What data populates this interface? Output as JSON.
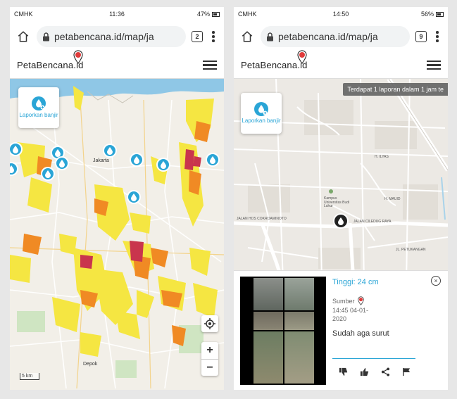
{
  "left_screen": {
    "status": {
      "carrier": "CMHK",
      "time": "11:36",
      "battery": "47%"
    },
    "browser": {
      "url": "petabencana.id/map/ja",
      "tab_count": "2"
    },
    "app": {
      "logo_text": "PetaBencana",
      "logo_suffix": ".id"
    },
    "map": {
      "report_button_label": "Laporkan banjir",
      "city_label": "Jakarta",
      "district_label": "Depok",
      "scale_label": "5 km",
      "zoom_in": "+",
      "zoom_out": "−"
    }
  },
  "right_screen": {
    "status": {
      "carrier": "CMHK",
      "time": "14:50",
      "battery": "56%"
    },
    "browser": {
      "url": "petabencana.id/map/ja",
      "tab_count": "9"
    },
    "app": {
      "logo_text": "PetaBencana",
      "logo_suffix": ".id"
    },
    "map": {
      "report_button_label": "Laporkan banjir",
      "notice": "Terdapat 1 laporan dalam 1 jam te",
      "road_labels": [
        "JALAN HOS COKROAMINOTO",
        "JALAN CILEDUG RAYA",
        "H. ILYAS",
        "Kampus Universitas Budi Luhur",
        "H. MAUID",
        "JL. PETUKANGAN"
      ]
    },
    "report": {
      "height_label": "Tinggi: 24 cm",
      "source_label": "Sumber",
      "timestamp": "14:45 04-01-2020",
      "description": "Sudah aga surut"
    }
  },
  "colors": {
    "brand_blue": "#2aa5d6",
    "flood_yellow": "#f5e642",
    "flood_orange": "#f08a24",
    "flood_red": "#c9354d",
    "logo_red": "#e03b3b"
  }
}
